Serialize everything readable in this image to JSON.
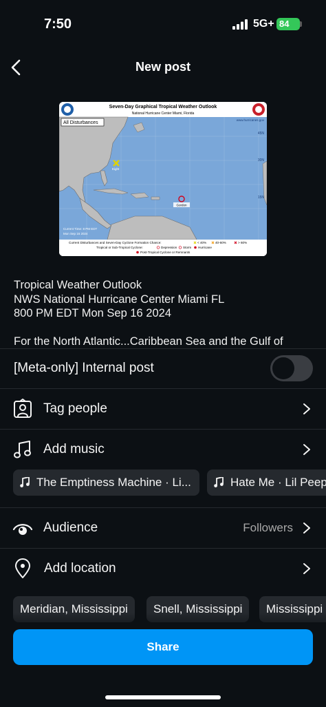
{
  "status_bar": {
    "time": "7:50",
    "network": "5G+",
    "battery": "84"
  },
  "header": {
    "title": "New post"
  },
  "thumbnail": {
    "title": "Seven-Day Graphical Tropical Weather Outlook",
    "subtitle": "National Hurricane Center  Miami, Florida",
    "site": "www.hurricanes.gov",
    "box_label": "All Disturbances",
    "timestamp_line1": "Current Time: 8 PM EDT",
    "timestamp_line2": "Mon Sep 16 2024",
    "marker_east": "Gordon",
    "marker_west": "Eight",
    "legend_line1": "Current Disturbances and Seven-Day Cyclone Formation Chance:",
    "legend_low": "< 40%",
    "legend_mid": "40-60%",
    "legend_high": "> 60%",
    "legend_line2": "Tropical or Sub-Tropical Cyclone:",
    "legend_depression": "Depression",
    "legend_storm": "Storm",
    "legend_hurricane": "Hurricane",
    "legend_line3": "Post-Tropical Cyclone or Remnants",
    "lat_45": "45N",
    "lat_30": "30N",
    "lat_15": "15N"
  },
  "caption": {
    "line1": "Tropical Weather Outlook",
    "line2": "NWS National Hurricane Center Miami FL",
    "line3": "800 PM EDT Mon Sep 16 2024",
    "line4": "For the North Atlantic...Caribbean Sea and the Gulf of"
  },
  "settings": {
    "internal_post": {
      "label": "[Meta-only] Internal post",
      "enabled": false
    },
    "tag_people": {
      "label": "Tag people",
      "icon": "tag-people-icon"
    },
    "add_music": {
      "label": "Add music",
      "icon": "music-note-icon",
      "suggestions": [
        "The Emptiness Machine · Li...",
        "Hate Me · Lil Peep"
      ]
    },
    "audience": {
      "label": "Audience",
      "value": "Followers",
      "icon": "eye-icon"
    },
    "add_location": {
      "label": "Add location",
      "icon": "location-pin-icon",
      "suggestions": [
        "Meridian, Mississippi",
        "Snell, Mississippi",
        "Mississippi"
      ]
    }
  },
  "share_button": {
    "label": "Share",
    "color": "#0095f6"
  },
  "colors": {
    "background": "#0c1014",
    "chip": "#25292e",
    "accent": "#0095f6",
    "battery": "#34c759"
  }
}
